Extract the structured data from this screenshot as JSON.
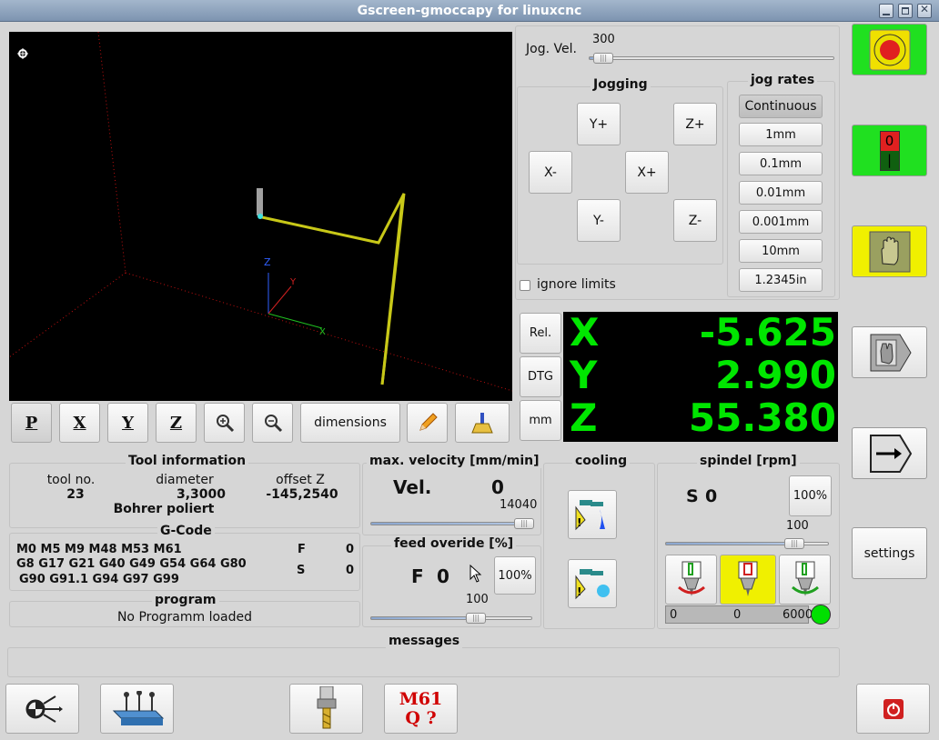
{
  "window": {
    "title": "Gscreen-gmoccapy for linuxcnc"
  },
  "plot": {
    "toolbar": {
      "dimensions_label": "dimensions"
    },
    "axis_labels": {
      "z": "Z",
      "x": "X",
      "y": "Y"
    }
  },
  "jog": {
    "vel_label": "Jog. Vel.",
    "vel_value": "300",
    "jogging_title": "Jogging",
    "buttons": {
      "y_plus": "Y+",
      "z_plus": "Z+",
      "x_minus": "X-",
      "x_plus": "X+",
      "y_minus": "Y-",
      "z_minus": "Z-"
    },
    "ignore_limits": "ignore limits",
    "rates_title": "jog rates",
    "rates": [
      "Continuous",
      "1mm",
      "0.1mm",
      "0.01mm",
      "0.001mm",
      "10mm",
      "1.2345in"
    ]
  },
  "dro": {
    "buttons": {
      "rel": "Rel.",
      "dtg": "DTG",
      "mm": "mm"
    },
    "axes": [
      {
        "letter": "X",
        "value": "-5.625"
      },
      {
        "letter": "Y",
        "value": "2.990"
      },
      {
        "letter": "Z",
        "value": "55.380"
      }
    ],
    "color": "#00e600"
  },
  "tool_info": {
    "title": "Tool information",
    "headers": {
      "tool_no": "tool no.",
      "diameter": "diameter",
      "offset_z": "offset Z"
    },
    "values": {
      "tool_no": "23",
      "diameter": "3,3000",
      "offset_z": "-145,2540"
    },
    "name": "Bohrer poliert"
  },
  "gcode": {
    "title": "G-Code",
    "lines": [
      "M0 M5 M9 M48 M53 M61",
      "G8 G17 G21 G40 G49 G54 G64 G80",
      "G90 G91.1 G94 G97 G99"
    ],
    "f_label": "F",
    "f_value": "0",
    "s_label": "S",
    "s_value": "0"
  },
  "program": {
    "title": "program",
    "status": "No Programm loaded"
  },
  "velocity": {
    "title": "max. velocity [mm/min]",
    "label": "Vel.",
    "value": "0",
    "max": "14040",
    "level": 1.0
  },
  "feed": {
    "title": "feed overide [%]",
    "label": "F",
    "value": "0",
    "reset_label": "100%",
    "slider_value": "100",
    "level": 0.58
  },
  "cooling": {
    "title": "cooling"
  },
  "spindle": {
    "title": "spindel [rpm]",
    "s_label": "S",
    "s_value": "0",
    "reset_label": "100%",
    "slider_value": "100",
    "level": 0.82,
    "bar_min": "0",
    "bar_value": "0",
    "bar_max": "6000",
    "led_color": "#00e000"
  },
  "messages": {
    "title": "messages"
  },
  "side": {
    "estop_bg": "#20e020",
    "power_bg": "#20e020",
    "manual_bg": "#f0f000",
    "power_off_label": "0",
    "power_on_label": "|",
    "settings_label": "settings"
  },
  "bottom": {
    "m61_line1": "M61",
    "m61_line2": "Q ?"
  }
}
